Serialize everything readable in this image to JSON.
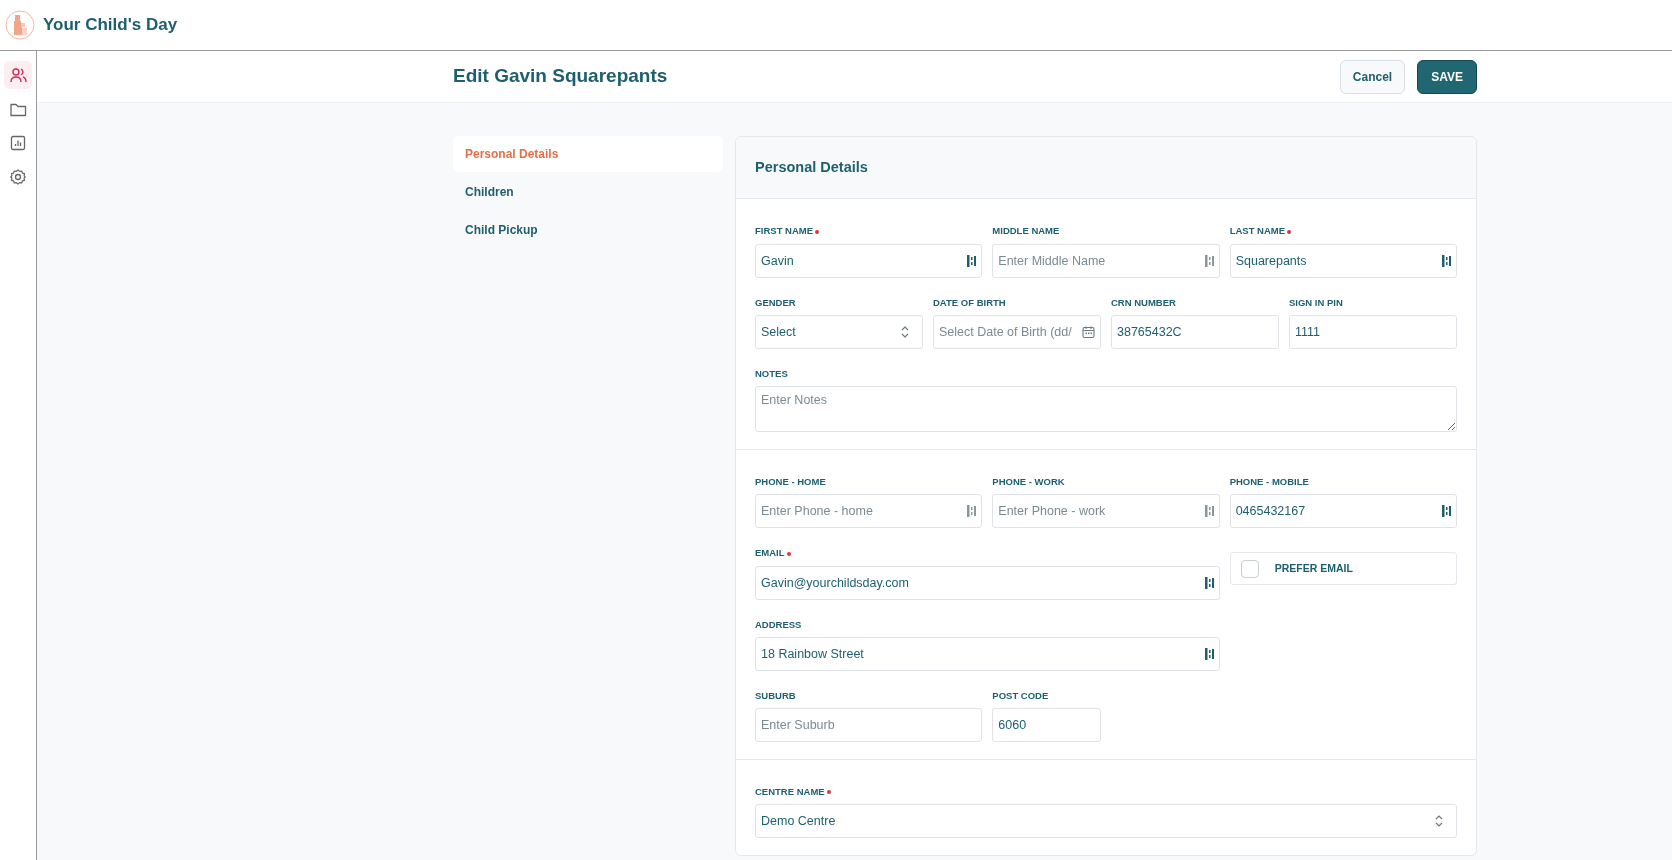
{
  "app": {
    "title": "Your Child's Day"
  },
  "sidebar": {
    "items": [
      {
        "kind": "people",
        "selected": true
      },
      {
        "kind": "folder",
        "selected": false
      },
      {
        "kind": "chart",
        "selected": false
      },
      {
        "kind": "settings",
        "selected": false
      }
    ]
  },
  "page": {
    "title": "Edit Gavin Squarepants",
    "buttons": [
      {
        "label": "Cancel",
        "kind": "secondary"
      },
      {
        "label": "SAVE",
        "kind": "primary"
      }
    ]
  },
  "section_nav": [
    {
      "label": "Personal Details",
      "selected": true
    },
    {
      "label": "Children",
      "selected": false
    },
    {
      "label": "Child Pickup",
      "selected": false
    }
  ],
  "form": {
    "title": "Personal Details",
    "sections": [
      {
        "rows": [
          [
            {
              "label": "FIRST NAME",
              "required": true,
              "kind": "text",
              "value": "Gavin",
              "autofill_icon": true
            },
            {
              "label": "MIDDLE NAME",
              "required": false,
              "kind": "text",
              "placeholder": "Enter Middle Name",
              "autofill_icon": true
            },
            {
              "label": "LAST NAME",
              "required": true,
              "kind": "text",
              "value": "Squarepants",
              "autofill_icon": true
            }
          ],
          [
            {
              "label": "GENDER",
              "required": false,
              "kind": "select",
              "value": "Select"
            },
            {
              "label": "DATE OF BIRTH",
              "required": false,
              "kind": "date",
              "placeholder": "Select Date of Birth (dd/"
            },
            {
              "label": "CRN NUMBER",
              "required": false,
              "kind": "text",
              "value": "38765432C",
              "autofill_icon": false
            },
            {
              "label": "SIGN IN PIN",
              "required": false,
              "kind": "text",
              "value": "1111",
              "autofill_icon": false
            }
          ],
          [
            {
              "label": "NOTES",
              "required": false,
              "kind": "textarea",
              "placeholder": "Enter Notes"
            }
          ]
        ]
      },
      {
        "rows": [
          [
            {
              "label": "PHONE - HOME",
              "required": false,
              "kind": "text",
              "placeholder": "Enter Phone - home",
              "autofill_icon": true
            },
            {
              "label": "PHONE - WORK",
              "required": false,
              "kind": "text",
              "placeholder": "Enter Phone - work",
              "autofill_icon": true
            },
            {
              "label": "PHONE - MOBILE",
              "required": false,
              "kind": "text",
              "value": "0465432167",
              "autofill_icon": true
            }
          ],
          [
            {
              "label": "EMAIL",
              "required": true,
              "kind": "text",
              "value": "Gavin@yourchildsday.com",
              "autofill_icon": true
            },
            {
              "label": "PREFER EMAIL",
              "kind": "checkbox",
              "checked": false
            }
          ],
          [
            {
              "label": "ADDRESS",
              "required": false,
              "kind": "text",
              "value": "18 Rainbow Street",
              "autofill_icon": true
            }
          ],
          [
            {
              "label": "SUBURB",
              "required": false,
              "kind": "text",
              "placeholder": "Enter Suburb",
              "autofill_icon": false
            },
            {
              "label": "POST CODE",
              "required": false,
              "kind": "text",
              "value": "6060",
              "autofill_icon": false
            }
          ]
        ]
      },
      {
        "rows": [
          [
            {
              "label": "CENTRE NAME",
              "required": true,
              "kind": "select",
              "value": "Demo Centre"
            }
          ]
        ]
      }
    ]
  }
}
